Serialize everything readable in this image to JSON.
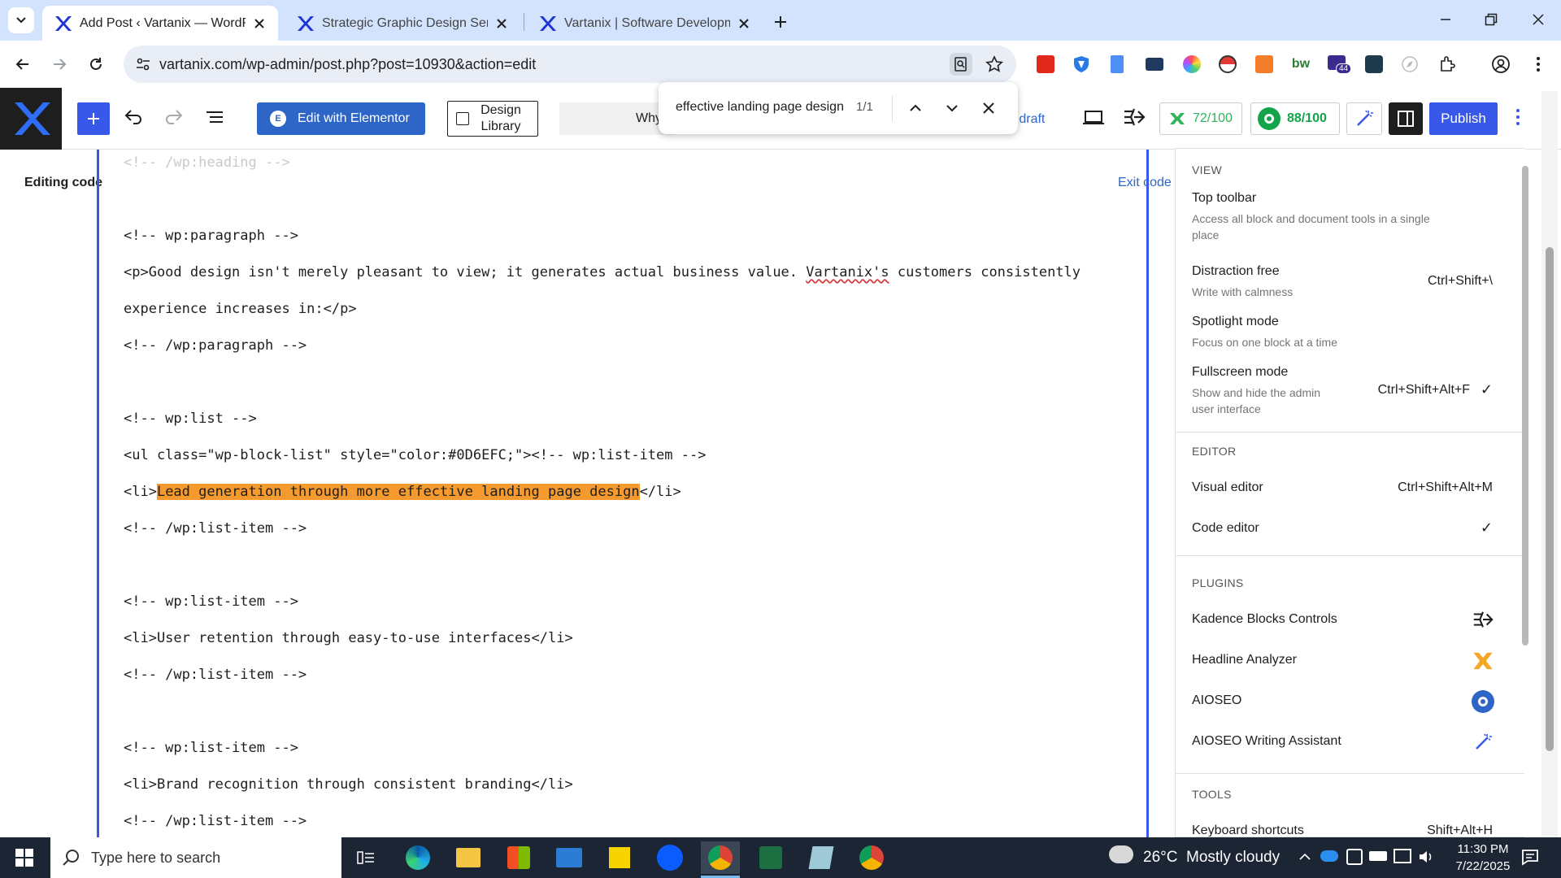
{
  "browser": {
    "tabs": [
      {
        "title": "Add Post ‹ Vartanix — WordPre",
        "active": true
      },
      {
        "title": "Strategic Graphic Design Servic",
        "active": false
      },
      {
        "title": "Vartanix | Software Developmen",
        "active": false
      }
    ],
    "url": "vartanix.com/wp-admin/post.php?post=10930&action=edit",
    "extension_badge": "44"
  },
  "wp_toolbar": {
    "edit_elementor": "Edit with Elementor",
    "design_library_1": "Design",
    "design_library_2": "Library",
    "partial_title": "Why",
    "save_draft_partial": "e draft",
    "headline_score": "72/100",
    "seo_score": "88/100",
    "publish": "Publish"
  },
  "find_bar": {
    "query": "effective landing page design",
    "count": "1/1"
  },
  "editor": {
    "notice": "Editing code",
    "exit": "Exit code",
    "line_1": "<!-- /wp:heading -->",
    "line_2": "<!-- wp:paragraph -->",
    "line_3a": "<p>Good design isn't merely pleasant to view; it generates actual business value. ",
    "line_3b": "Vartanix's",
    "line_3c": " customers consistently",
    "line_4": "experience increases in:</p>",
    "line_5": "<!-- /wp:paragraph -->",
    "line_6": "<!-- wp:list -->",
    "line_7": "<ul class=\"wp-block-list\" style=\"color:#0D6EFC;\"><!-- wp:list-item -->",
    "line_8a": "<li>",
    "line_8b": "Lead generation through more effective landing page design",
    "line_8c": "</li>",
    "line_9": "<!-- /wp:list-item -->",
    "line_10": "<!-- wp:list-item -->",
    "line_11": "<li>User retention through easy-to-use interfaces</li>",
    "line_12": "<!-- /wp:list-item -->",
    "line_13": "<!-- wp:list-item -->",
    "line_14": "<li>Brand recognition through consistent branding</li>",
    "line_15": "<!-- /wp:list-item -->"
  },
  "options_menu": {
    "view_header": "VIEW",
    "top_toolbar": "Top toolbar",
    "top_toolbar_desc_1": "Access all block and document tools in a single",
    "top_toolbar_desc_2": "place",
    "distraction_free": "Distraction free",
    "distraction_free_desc": "Write with calmness",
    "distraction_free_shortcut": "Ctrl+Shift+\\",
    "spotlight": "Spotlight mode",
    "spotlight_desc": "Focus on one block at a time",
    "fullscreen": "Fullscreen mode",
    "fullscreen_desc_1": "Show and hide the admin",
    "fullscreen_desc_2": "user interface",
    "fullscreen_shortcut": "Ctrl+Shift+Alt+F",
    "editor_header": "EDITOR",
    "visual_editor": "Visual editor",
    "visual_editor_shortcut": "Ctrl+Shift+Alt+M",
    "code_editor": "Code editor",
    "plugins_header": "PLUGINS",
    "plugin_1": "Kadence Blocks Controls",
    "plugin_2": "Headline Analyzer",
    "plugin_3": "AIOSEO",
    "plugin_4": "AIOSEO Writing Assistant",
    "tools_header": "TOOLS",
    "keyboard_shortcuts": "Keyboard shortcuts",
    "keyboard_shortcuts_key": "Shift+Alt+H",
    "checkmark": "✓"
  },
  "taskbar": {
    "search_placeholder": "Type here to search",
    "weather": "26°C  Mostly cloudy",
    "time": "11:30 PM",
    "date": "7/22/2025"
  },
  "colors": {
    "wp_blue": "#3858e9",
    "highlight": "#f59a2e",
    "tab_strip": "#d3e3fd",
    "headline_green": "#2fb35a",
    "seo_green": "#12a44a"
  }
}
